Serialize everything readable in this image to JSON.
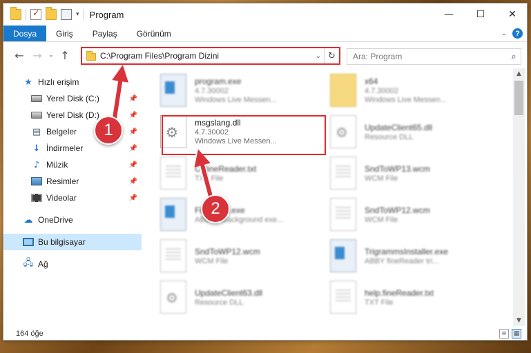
{
  "window": {
    "title": "Program",
    "controls": {
      "minimize": "—",
      "maximize": "☐",
      "close": "✕"
    }
  },
  "ribbon": {
    "tabs": [
      {
        "label": "Dosya"
      },
      {
        "label": "Giriş"
      },
      {
        "label": "Paylaş"
      },
      {
        "label": "Görünüm"
      }
    ],
    "help": "?"
  },
  "navigation": {
    "back": "←",
    "forward": "→",
    "recent": "⌄",
    "up": "↑",
    "address_path": "C:\\Program Files\\Program Dizini",
    "refresh": "↻",
    "search_placeholder": "Ara: Program"
  },
  "sidebar": {
    "items": [
      {
        "label": "Hızlı erişim",
        "icon": "star-icon",
        "pinned": false
      },
      {
        "label": "Yerel Disk (C:)",
        "icon": "disk-icon",
        "pinned": true
      },
      {
        "label": "Yerel Disk (D:)",
        "icon": "disk-icon",
        "pinned": true
      },
      {
        "label": "Belgeler",
        "icon": "documents-icon",
        "pinned": true
      },
      {
        "label": "İndirmeler",
        "icon": "download-icon",
        "pinned": true
      },
      {
        "label": "Müzik",
        "icon": "music-icon",
        "pinned": true
      },
      {
        "label": "Resimler",
        "icon": "pictures-icon",
        "pinned": true
      },
      {
        "label": "Videolar",
        "icon": "videos-icon",
        "pinned": true
      },
      {
        "label": "OneDrive",
        "icon": "onedrive-icon",
        "pinned": false
      },
      {
        "label": "Bu bilgisayar",
        "icon": "computer-icon",
        "pinned": false,
        "selected": true
      },
      {
        "label": "Ağ",
        "icon": "network-icon",
        "pinned": false
      }
    ],
    "pin_glyph": "📌"
  },
  "files": [
    {
      "name": "program.exe",
      "line2": "4.7.30002",
      "line3": "Windows Live Messen...",
      "type": "exe"
    },
    {
      "name": "x64",
      "line2": "4.7.30002",
      "line3": "Windows Live Messen...",
      "type": "folder"
    },
    {
      "name": "msgslang.dll",
      "line2": "4.7.30002",
      "line3": "Windows Live Messen...",
      "type": "dll",
      "highlighted": true
    },
    {
      "name": "UpdateClient65.dll",
      "line2": "Resource DLL",
      "line3": "",
      "type": "dll"
    },
    {
      "name": "OfflineReader.txt",
      "line2": "TXT File",
      "line3": "",
      "type": "txt"
    },
    {
      "name": "SndToWP13.wcm",
      "line2": "WCM File",
      "line3": "",
      "type": "txt"
    },
    {
      "name": "FineExec.exe",
      "line2": "ABBYY Background exe...",
      "line3": "",
      "type": "exe"
    },
    {
      "name": "SndToWP12.wcm",
      "line2": "WCM File",
      "line3": "",
      "type": "txt"
    },
    {
      "name": "SndToWP12.wcm",
      "line2": "WCM File",
      "line3": "",
      "type": "txt"
    },
    {
      "name": "TrigrammsInstaller.exe",
      "line2": "ABBY fineReader tri...",
      "line3": "",
      "type": "exe"
    },
    {
      "name": "UpdateClient63.dll",
      "line2": "Resource DLL",
      "line3": "",
      "type": "dll"
    },
    {
      "name": "help.fineReader.txt",
      "line2": "TXT File",
      "line3": "",
      "type": "txt"
    }
  ],
  "status": {
    "count": "164 öğe"
  },
  "markers": [
    {
      "label": "1"
    },
    {
      "label": "2"
    }
  ],
  "colors": {
    "accent": "#1979ca",
    "highlight_border": "#e0292c",
    "marker": "#d8323a",
    "selected_bg": "#cce8ff"
  }
}
